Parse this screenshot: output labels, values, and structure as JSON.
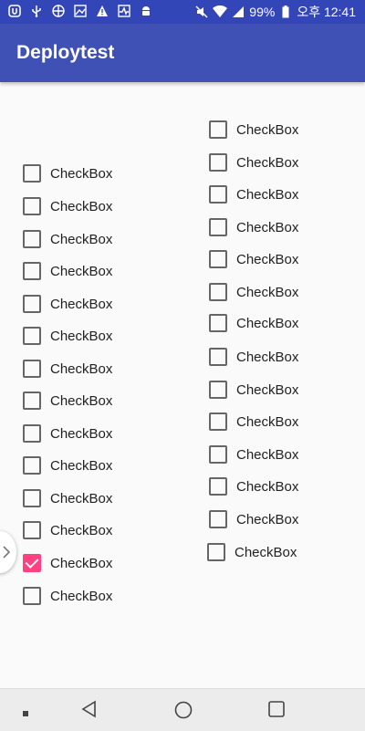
{
  "statusbar": {
    "left_icons": [
      "u-icon",
      "usb-icon",
      "pinwheel-icon",
      "image-icon",
      "warning-icon",
      "pulse-icon",
      "android-icon"
    ],
    "battery": "99%",
    "time": "오후 12:41"
  },
  "appbar": {
    "title": "Deploytest"
  },
  "checkbox_label": "CheckBox",
  "left_column": [
    {
      "label": "CheckBox",
      "checked": false
    },
    {
      "label": "CheckBox",
      "checked": false
    },
    {
      "label": "CheckBox",
      "checked": false
    },
    {
      "label": "CheckBox",
      "checked": false
    },
    {
      "label": "CheckBox",
      "checked": false
    },
    {
      "label": "CheckBox",
      "checked": false
    },
    {
      "label": "CheckBox",
      "checked": false
    },
    {
      "label": "CheckBox",
      "checked": false
    },
    {
      "label": "CheckBox",
      "checked": false
    },
    {
      "label": "CheckBox",
      "checked": false
    },
    {
      "label": "CheckBox",
      "checked": false
    },
    {
      "label": "CheckBox",
      "checked": false
    },
    {
      "label": "CheckBox",
      "checked": true
    },
    {
      "label": "CheckBox",
      "checked": false
    }
  ],
  "right_column": [
    {
      "label": "CheckBox",
      "checked": false
    },
    {
      "label": "CheckBox",
      "checked": false
    },
    {
      "label": "CheckBox",
      "checked": false
    },
    {
      "label": "CheckBox",
      "checked": false
    },
    {
      "label": "CheckBox",
      "checked": false
    },
    {
      "label": "CheckBox",
      "checked": false
    },
    {
      "label": "CheckBox",
      "checked": false
    },
    {
      "label": "CheckBox",
      "checked": false
    },
    {
      "label": "CheckBox",
      "checked": false
    },
    {
      "label": "CheckBox",
      "checked": false
    },
    {
      "label": "CheckBox",
      "checked": false
    },
    {
      "label": "CheckBox",
      "checked": false
    },
    {
      "label": "CheckBox",
      "checked": false
    },
    {
      "label": "CheckBox",
      "checked": false
    }
  ],
  "colors": {
    "primary": "#3f51b5",
    "status": "#3346b8",
    "accent": "#ff4081"
  },
  "navbar": {
    "buttons": [
      "square-dot-icon",
      "back-icon",
      "home-icon",
      "recents-icon"
    ]
  }
}
